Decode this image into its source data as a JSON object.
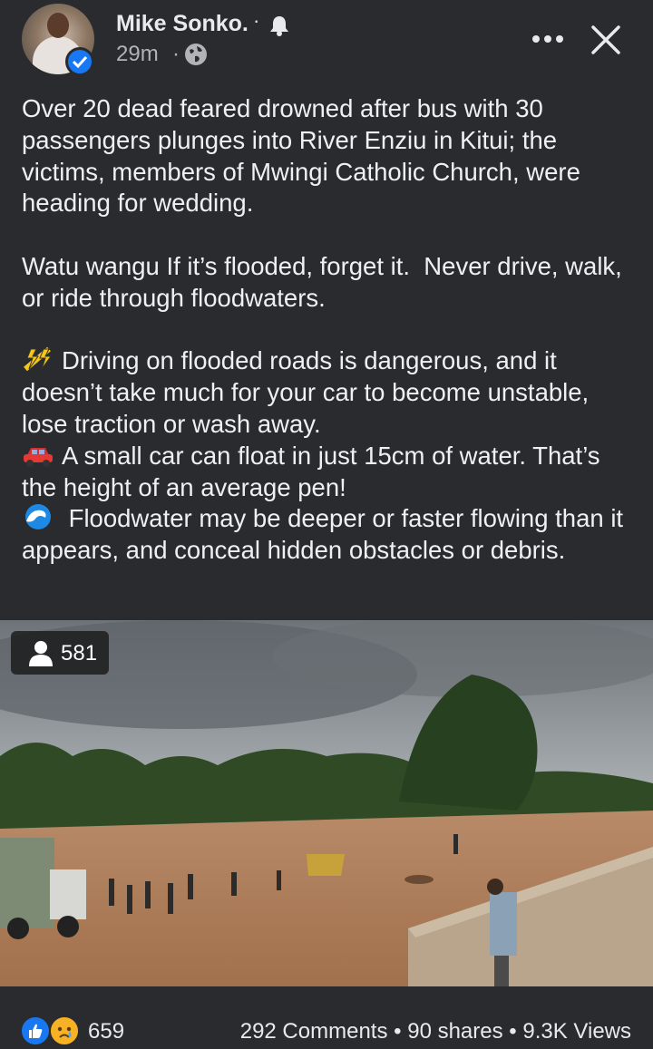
{
  "header": {
    "author": "Mike Sonko.",
    "separator": "·",
    "time": "29m",
    "time_separator": "·",
    "icons": [
      "verified-badge-icon",
      "bell-icon",
      "globe-icon",
      "more-icon",
      "close-icon"
    ]
  },
  "post": {
    "paragraph1": "Over 20 dead feared drowned after bus with 30 passengers plunges into River Enziu in Kitui; the victims, members of Mwingi Catholic Church, were heading for wedding.",
    "paragraph2": "Watu wangu If it’s flooded, forget it.  Never drive, walk, or ride through floodwaters.",
    "tip1": "Driving on flooded roads is dangerous, and it doesn’t take much for your car to become unstable, lose traction or wash away.",
    "tip2": "A small car can float in just 15cm of water. That’s the height of an average pen!",
    "tip3": " Floodwater may be deeper or faster flowing than it appears, and conceal hidden obstacles or debris."
  },
  "media": {
    "viewer_count": "581"
  },
  "footer": {
    "reaction_count": "659",
    "comments": "292 Comments",
    "shares": "90 shares",
    "views": "9.3K Views",
    "dot": " • "
  },
  "colors": {
    "background": "#2a2b2e",
    "accent": "#1877f2",
    "text": "#e8eaed",
    "secondary_text": "#b0b3b8"
  }
}
